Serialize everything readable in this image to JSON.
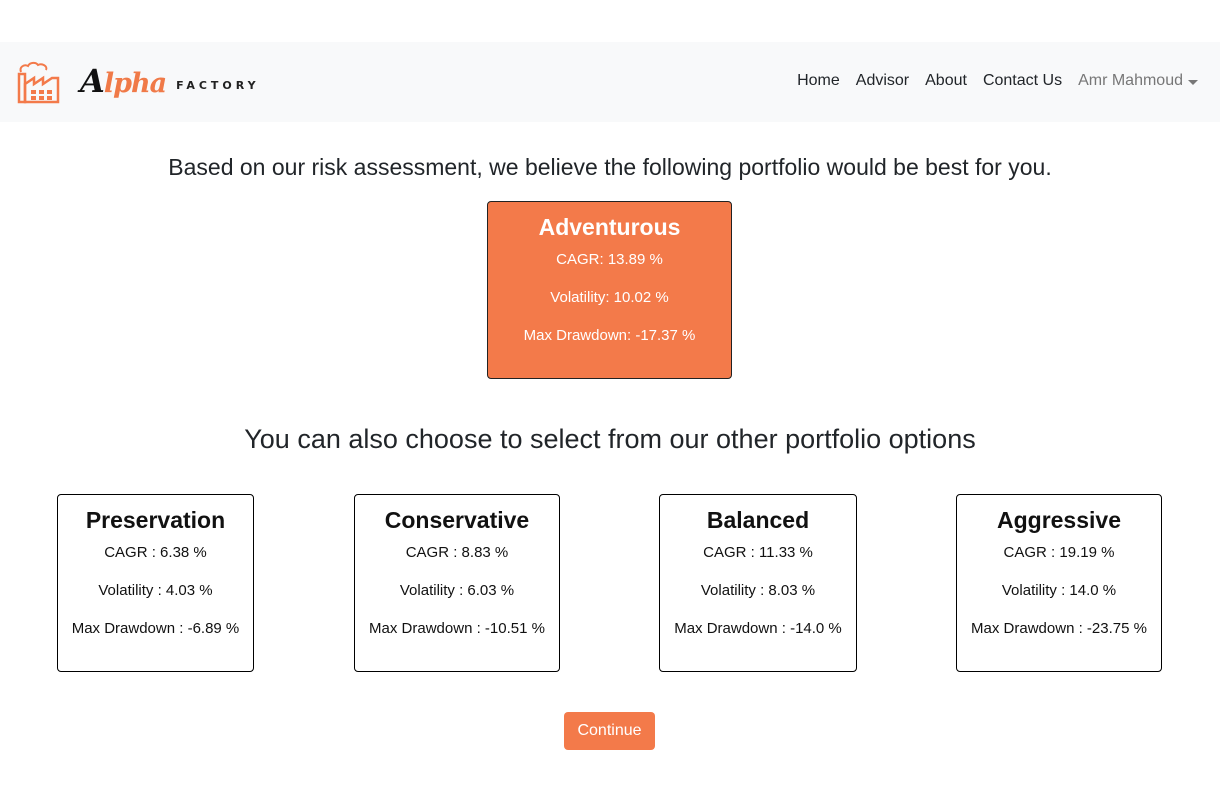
{
  "brand": {
    "script_first": "A",
    "script_rest": "lpha",
    "sub": "FACTORY",
    "icon": "factory-icon",
    "accent": "#f37a4a"
  },
  "nav": {
    "home": "Home",
    "advisor": "Advisor",
    "about": "About",
    "contact": "Contact Us",
    "user": "Amr Mahmoud"
  },
  "headline_recommend": "Based on our risk assessment, we believe the following portfolio would be best for you.",
  "recommended": {
    "name": "Adventurous",
    "cagr": "CAGR: 13.89 %",
    "volatility": "Volatility: 10.02 %",
    "drawdown": "Max Drawdown: -17.37 %"
  },
  "headline_other": "You can also choose to select from our other portfolio options",
  "options": [
    {
      "name": "Preservation",
      "cagr": "CAGR : 6.38 %",
      "volatility": "Volatility : 4.03 %",
      "drawdown": "Max Drawdown : -6.89 %"
    },
    {
      "name": "Conservative",
      "cagr": "CAGR : 8.83 %",
      "volatility": "Volatility : 6.03 %",
      "drawdown": "Max Drawdown : -10.51 %"
    },
    {
      "name": "Balanced",
      "cagr": "CAGR : 11.33 %",
      "volatility": "Volatility : 8.03 %",
      "drawdown": "Max Drawdown : -14.0 %"
    },
    {
      "name": "Aggressive",
      "cagr": "CAGR : 19.19 %",
      "volatility": "Volatility : 14.0 %",
      "drawdown": "Max Drawdown : -23.75 %"
    }
  ],
  "continue_label": "Continue"
}
